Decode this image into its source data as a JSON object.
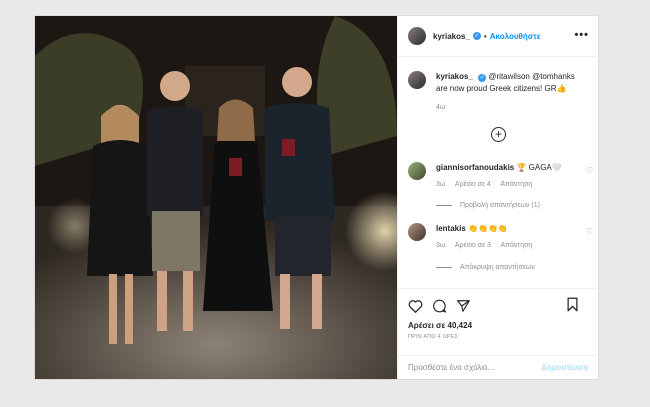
{
  "post": {
    "username": "kyriakos_",
    "follow_label": "Ακολουθήστε",
    "more_label": "•••",
    "caption_user": "kyriakos_",
    "caption_mentions": "@ritawilson @tomhanks",
    "caption_text": "are now proud Greek citizens! GR👍",
    "caption_time": "4ω",
    "plus_label": "+",
    "likes_text": "Αρέσει σε 40,424",
    "time_ago": "ΠΡΙΝ ΑΠΟ 4 ΩΡΕΣ",
    "comment_placeholder": "Προσθέστε ένα σχόλιο...",
    "post_label": "Δημοσίευση"
  },
  "comments": [
    {
      "user": "giannisorfanoudakis",
      "text": "🏆 GAGA🤍",
      "time": "3ω",
      "likes": "Αρέσει σε 4",
      "reply": "Απάντηση",
      "replies_label": "Προβολή απαντήσεων (1)"
    },
    {
      "user": "lentakis",
      "text": "👏👏👏👏",
      "time": "3ω",
      "likes": "Αρέσει σε 3",
      "reply": "Απάντηση",
      "replies_label": "Απόκρυψη απαντήσεων"
    }
  ],
  "colors": {
    "accent": "#0095f6",
    "verified": "#3897f0",
    "post_disabled": "#b2dffc"
  },
  "icons": [
    "verified-badge-icon",
    "heart-icon",
    "comment-icon",
    "share-icon",
    "bookmark-icon",
    "add-icon"
  ]
}
